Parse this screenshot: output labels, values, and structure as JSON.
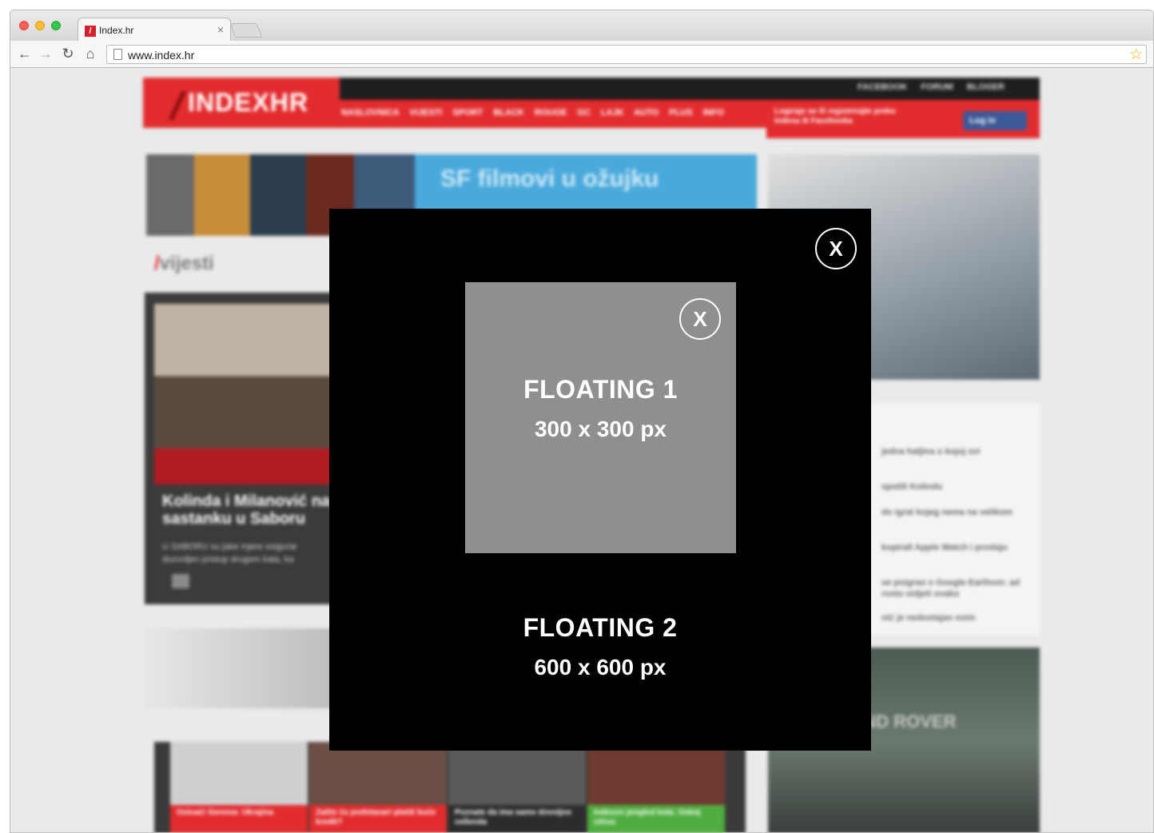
{
  "browser": {
    "tab_title": "Index.hr",
    "tab_favicon": "/",
    "tab_close": "×",
    "url": "www.index.hr",
    "icons": {
      "back": "back-arrow-icon",
      "forward": "forward-arrow-icon",
      "reload": "reload-icon",
      "home": "home-icon",
      "bookmark": "star-icon"
    }
  },
  "site": {
    "logo": "INDEXHR",
    "top_links": "FACEBOOK FORUM BLOGER",
    "main_nav": "NASLOVNICA VIJESTI SPORT BLACK ROUGE GC LAJK AUTO PLUS INFO",
    "login_prompt": "Logiraje se ili registrirajte preko Indexa ili Facebooka",
    "facebook_login": "Log in",
    "banner_text": "SF filmovi u ožujku",
    "section_slash": "/",
    "section_name": "vijesti",
    "story_headline": "Kolinda i Milanović na sastanku u Saboru",
    "story_lede": "U SABORU su jake mjere osigurar dozvoljen pristup drugom kata, ka",
    "related": [
      "jedna haljina o kojoj svi",
      "spotili Kolindu",
      "do igrat kojeg nema na velikom",
      "kopirali Apple Watch i prodaju",
      "se poigrao s Google Earthom: ad rosto vidjeti ovako",
      "nić je nedostajao svim"
    ],
    "carousel": [
      "Ostvaić Genova: Ukrajina",
      "Zašto ću podstanari platiti kuće kredit?",
      "Poznate da ima samo dovoljno cellenda",
      "Indexov pregled kola: Oskoj citrus"
    ],
    "land_rover": "LAND ROVER"
  },
  "overlay": {
    "close_outer": "X",
    "close_inner": "X",
    "floating1_title": "FLOATING 1",
    "floating1_size": "300 x 300 px",
    "floating2_title": "FLOATING 2",
    "floating2_size": "600 x 600 px"
  },
  "colors": {
    "overlay_bg": "#000000",
    "floating1_bg": "#8f8f8f",
    "brand_red": "#e32c2e"
  }
}
